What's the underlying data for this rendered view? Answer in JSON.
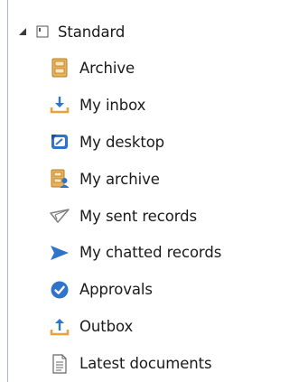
{
  "tree": {
    "root": {
      "label": "Standard",
      "expander_icon": "expanded-triangle-icon",
      "icon": "folder-page-icon"
    },
    "items": [
      {
        "label": "Archive",
        "icon": "archive-icon",
        "color": "#d9a04a"
      },
      {
        "label": "My inbox",
        "icon": "inbox-download-icon",
        "color": "#e8a33a"
      },
      {
        "label": "My desktop",
        "icon": "desktop-icon",
        "color": "#2f74c8"
      },
      {
        "label": "My archive",
        "icon": "my-archive-icon",
        "color": "#d9a04a"
      },
      {
        "label": "My sent records",
        "icon": "sent-paper-plane-icon",
        "color": "#808080"
      },
      {
        "label": "My chatted records",
        "icon": "send-arrow-icon",
        "color": "#2f74c8"
      },
      {
        "label": "Approvals",
        "icon": "check-circle-icon",
        "color": "#2f74c8"
      },
      {
        "label": "Outbox",
        "icon": "outbox-upload-icon",
        "color": "#e8a33a"
      },
      {
        "label": "Latest documents",
        "icon": "document-icon",
        "color": "#666666"
      }
    ]
  }
}
